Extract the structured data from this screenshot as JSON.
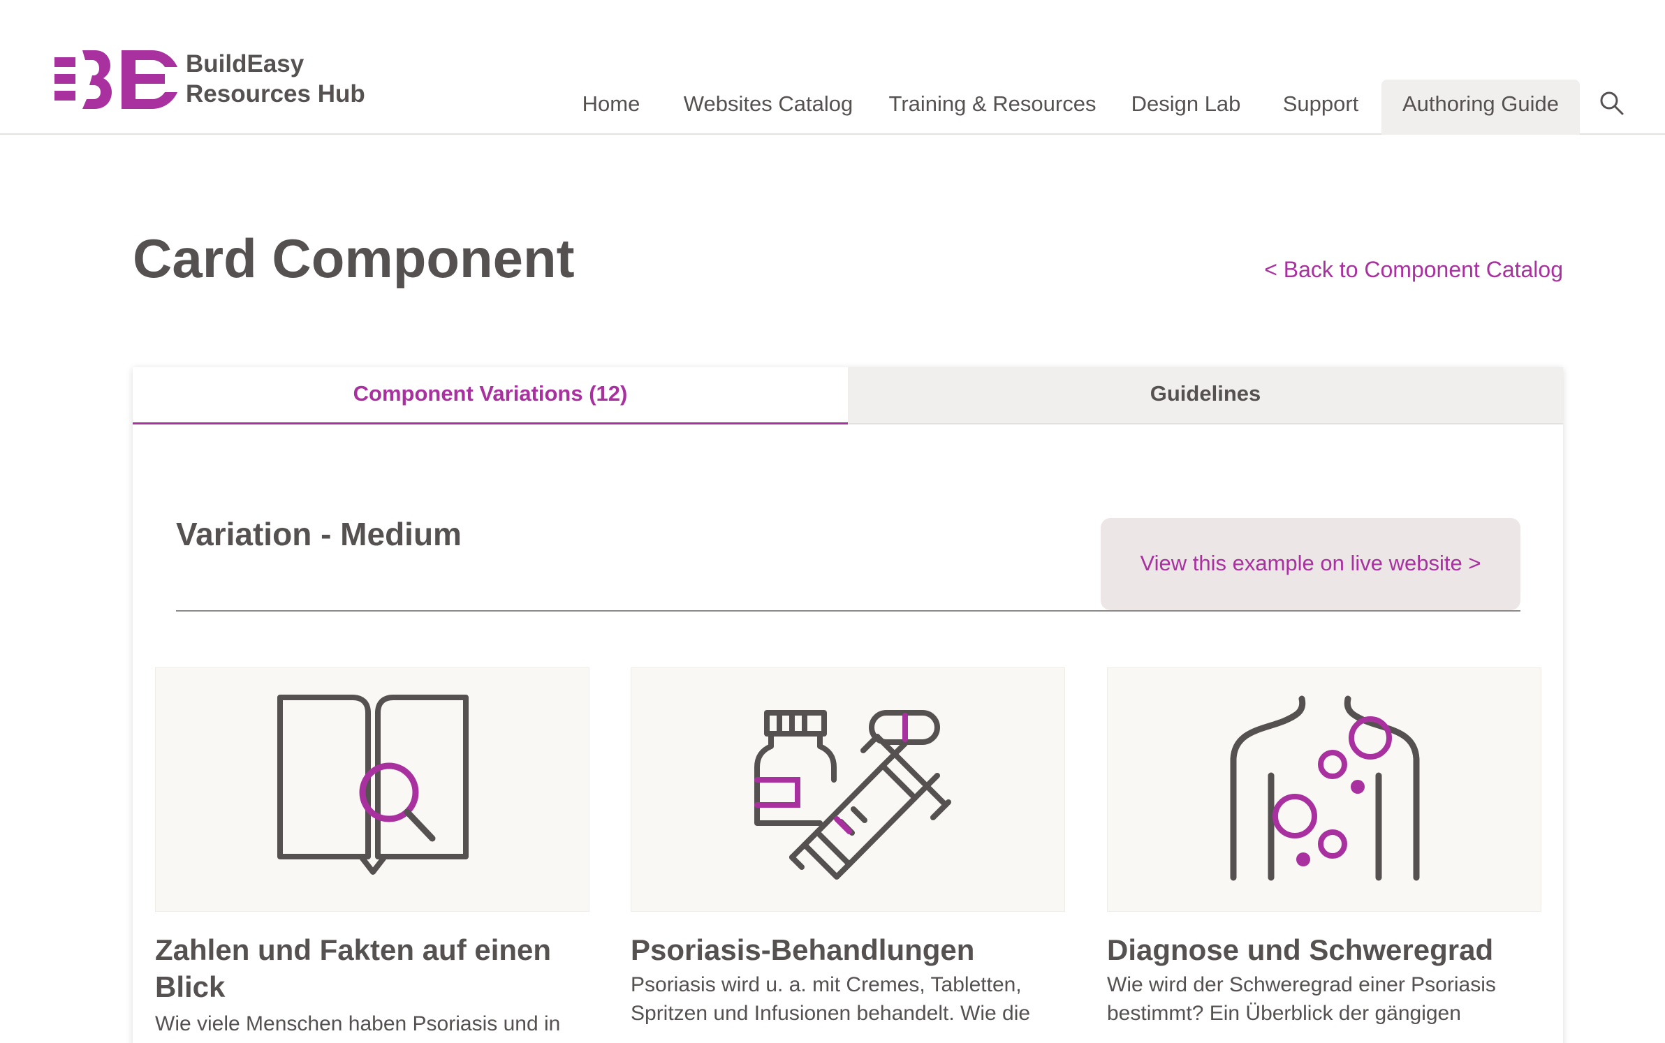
{
  "header": {
    "logo_line1": "BuildEasy",
    "logo_line2": "Resources Hub",
    "nav": [
      "Home",
      "Websites Catalog",
      "Training & Resources",
      "Design Lab",
      "Support",
      "Authoring Guide"
    ],
    "active_nav": "Authoring Guide",
    "search_icon": "search-icon"
  },
  "page": {
    "title": "Card Component",
    "back_link": "< Back to Component Catalog"
  },
  "tabs": {
    "variations": "Component Variations (12)",
    "guidelines": "Guidelines",
    "active": "Component Variations (12)"
  },
  "variation": {
    "title": "Variation - Medium",
    "live_button": "View this example on live website >"
  },
  "cards": [
    {
      "icon": "book-magnifier-icon",
      "title": "Zahlen und Fakten auf einen Blick",
      "text": "Wie viele Menschen haben Psoriasis und in"
    },
    {
      "icon": "medication-syringe-icon",
      "title": "Psoriasis-Behandlungen",
      "text": "Psoriasis wird u. a. mit Cremes, Tabletten, Spritzen und Infusionen behandelt. Wie die"
    },
    {
      "icon": "body-skin-spots-icon",
      "title": "Diagnose und Schweregrad",
      "text": "Wie wird der Schweregrad einer Psoriasis bestimmt? Ein Überblick der gängigen"
    }
  ],
  "colors": {
    "accent": "#a8319f",
    "text": "#555150",
    "tab_inactive_bg": "#f1efee",
    "card_bg": "#faf8f5",
    "button_bg": "#ece6e6"
  }
}
